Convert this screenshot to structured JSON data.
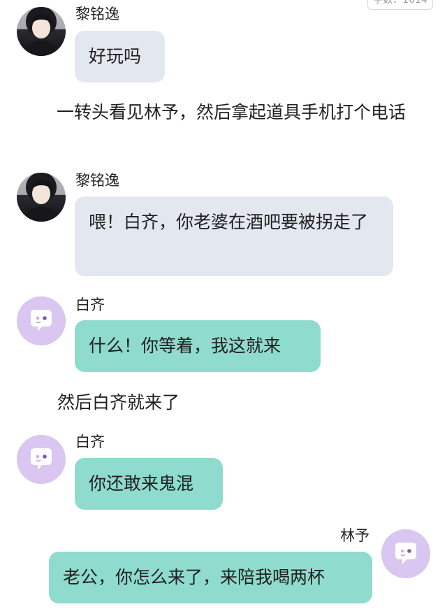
{
  "header": {
    "word_count": "字数：1614"
  },
  "messages": [
    {
      "speaker": "黎铭逸",
      "text": "好玩吗",
      "side": "left",
      "bubble_color": "#e3e7ef",
      "avatar": "portrait-photo"
    },
    {
      "speaker": "黎铭逸",
      "text": "喂！白齐，你老婆在酒吧要被拐走了",
      "side": "left",
      "bubble_color": "#e3e7ef",
      "avatar": "portrait-photo"
    },
    {
      "speaker": "白齐",
      "text": "什么！你等着，我这就来",
      "side": "left",
      "bubble_color": "#8fdbcd",
      "avatar": "chat-bot-icon"
    },
    {
      "speaker": "白齐",
      "text": "你还敢来鬼混",
      "side": "left",
      "bubble_color": "#8fdbcd",
      "avatar": "chat-bot-icon"
    },
    {
      "speaker": "林予",
      "text": "老公，你怎么来了，来陪我喝两杯",
      "side": "right",
      "bubble_color": "#8fdbcd",
      "avatar": "chat-bot-icon"
    }
  ],
  "narrations": [
    "一转头看见林予，然后拿起道具手机打个电话",
    "然后白齐就来了"
  ]
}
